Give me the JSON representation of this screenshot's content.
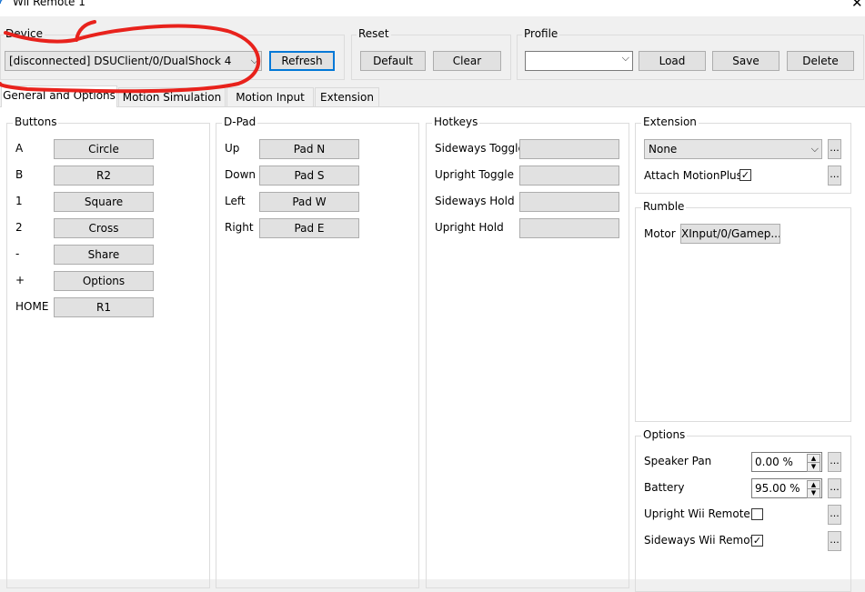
{
  "window": {
    "title": "Wii Remote 1",
    "close_glyph": "✕"
  },
  "device": {
    "group_label": "Device",
    "value": "[disconnected] DSUClient/0/DualShock 4",
    "refresh_label": "Refresh"
  },
  "reset": {
    "group_label": "Reset",
    "default_label": "Default",
    "clear_label": "Clear"
  },
  "profile": {
    "group_label": "Profile",
    "value": "",
    "load_label": "Load",
    "save_label": "Save",
    "delete_label": "Delete"
  },
  "tabs": [
    {
      "label": "General and Options"
    },
    {
      "label": "Motion Simulation"
    },
    {
      "label": "Motion Input"
    },
    {
      "label": "Extension"
    }
  ],
  "buttons": {
    "group_label": "Buttons",
    "rows": [
      {
        "label": "A",
        "value": "Circle"
      },
      {
        "label": "B",
        "value": "R2"
      },
      {
        "label": "1",
        "value": "Square"
      },
      {
        "label": "2",
        "value": "Cross"
      },
      {
        "label": "-",
        "value": "Share"
      },
      {
        "label": "+",
        "value": "Options"
      },
      {
        "label": "HOME",
        "value": "R1"
      }
    ]
  },
  "dpad": {
    "group_label": "D-Pad",
    "rows": [
      {
        "label": "Up",
        "value": "Pad N"
      },
      {
        "label": "Down",
        "value": "Pad S"
      },
      {
        "label": "Left",
        "value": "Pad W"
      },
      {
        "label": "Right",
        "value": "Pad E"
      }
    ]
  },
  "hotkeys": {
    "group_label": "Hotkeys",
    "rows": [
      {
        "label": "Sideways Toggle",
        "value": ""
      },
      {
        "label": "Upright Toggle",
        "value": ""
      },
      {
        "label": "Sideways Hold",
        "value": ""
      },
      {
        "label": "Upright Hold",
        "value": ""
      }
    ]
  },
  "extension": {
    "group_label": "Extension",
    "selected": "None",
    "motionplus_label": "Attach MotionPlus",
    "motionplus_checked": true,
    "more_label": "..."
  },
  "rumble": {
    "group_label": "Rumble",
    "motor_label": "Motor",
    "motor_value": "XInput/0/Gamep..."
  },
  "options": {
    "group_label": "Options",
    "speaker_pan_label": "Speaker Pan",
    "speaker_pan_value": "0.00 %",
    "battery_label": "Battery",
    "battery_value": "95.00 %",
    "upright_label": "Upright Wii Remote",
    "upright_checked": false,
    "sideways_label": "Sideways Wii Remote",
    "sideways_checked": true
  },
  "annotation": {
    "color": "#e8221c"
  },
  "icons": {
    "title_icon": "wiimote-app-icon",
    "check_glyph": "✓",
    "dropdown_glyph": "⌵",
    "spin_up": "▲",
    "spin_down": "▼"
  }
}
